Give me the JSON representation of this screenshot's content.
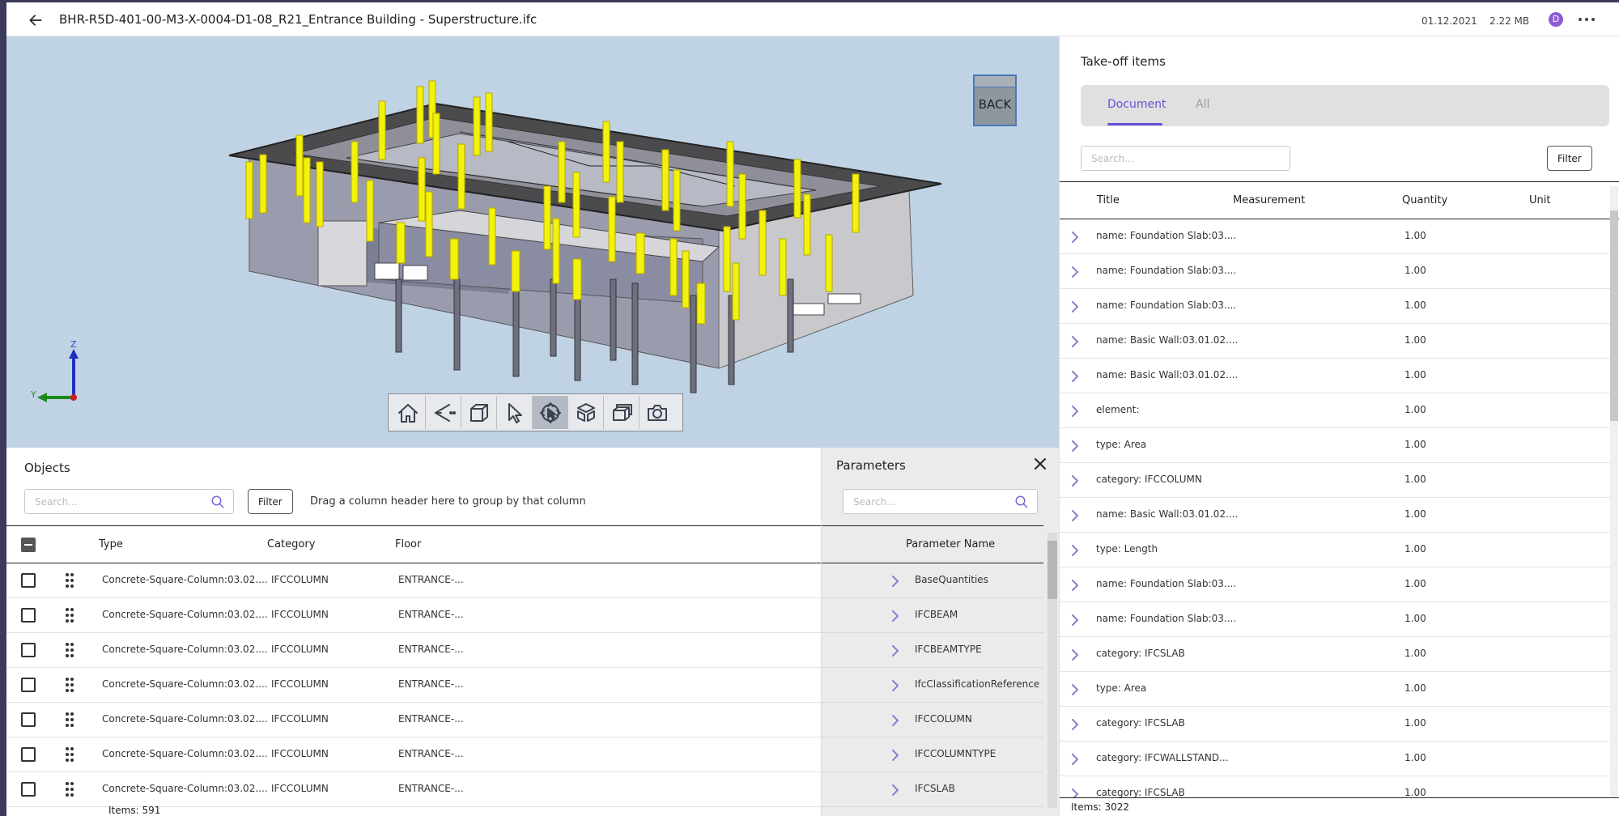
{
  "header": {
    "title": "BHR-R5D-401-00-M3-X-0004-D1-08_R21_Entrance Building - Superstructure.ifc",
    "date": "01.12.2021",
    "size": "2.22 MB",
    "user_initial": "D",
    "icons": {
      "back": "arrow-left-icon",
      "more": "more-horizontal-icon"
    }
  },
  "viewer": {
    "view_cube_label": "BACK",
    "axis_labels": {
      "z": "Z",
      "y": "Y"
    },
    "toolbar": [
      {
        "name": "home-icon"
      },
      {
        "name": "camera-fov-icon"
      },
      {
        "name": "cube-view-icon"
      },
      {
        "name": "pointer-select-icon"
      },
      {
        "name": "orbit-icon",
        "active": true
      },
      {
        "name": "explode-model-icon"
      },
      {
        "name": "section-box-icon"
      },
      {
        "name": "screenshot-camera-icon"
      }
    ]
  },
  "objects": {
    "title": "Objects",
    "search_placeholder": "Search...",
    "filter_label": "Filter",
    "group_hint": "Drag a column header here to group by that column",
    "columns": [
      "Type",
      "Category",
      "Floor"
    ],
    "rows": [
      {
        "type": "Concrete-Square-Column:03.02....",
        "category": "IFCCOLUMN",
        "floor": "ENTRANCE-..."
      },
      {
        "type": "Concrete-Square-Column:03.02....",
        "category": "IFCCOLUMN",
        "floor": "ENTRANCE-..."
      },
      {
        "type": "Concrete-Square-Column:03.02....",
        "category": "IFCCOLUMN",
        "floor": "ENTRANCE-..."
      },
      {
        "type": "Concrete-Square-Column:03.02....",
        "category": "IFCCOLUMN",
        "floor": "ENTRANCE-..."
      },
      {
        "type": "Concrete-Square-Column:03.02....",
        "category": "IFCCOLUMN",
        "floor": "ENTRANCE-..."
      },
      {
        "type": "Concrete-Square-Column:03.02....",
        "category": "IFCCOLUMN",
        "floor": "ENTRANCE-..."
      },
      {
        "type": "Concrete-Square-Column:03.02....",
        "category": "IFCCOLUMN",
        "floor": "ENTRANCE-..."
      }
    ],
    "items_label": "Items:",
    "items_count": "591"
  },
  "parameters": {
    "title": "Parameters",
    "search_placeholder": "Search...",
    "column": "Parameter Name",
    "rows": [
      "BaseQuantities",
      "IFCBEAM",
      "IFCBEAMTYPE",
      "IfcClassificationReference",
      "IFCCOLUMN",
      "IFCCOLUMNTYPE",
      "IFCSLAB"
    ]
  },
  "takeoff": {
    "title": "Take-off items",
    "tabs": [
      "Document",
      "All"
    ],
    "active_tab": "Document",
    "search_placeholder": "Search...",
    "filter_label": "Filter",
    "columns": [
      "Title",
      "Measurement",
      "Quantity",
      "Unit"
    ],
    "rows": [
      {
        "title": "name: Foundation Slab:03....",
        "quantity": "1.00"
      },
      {
        "title": "name: Foundation Slab:03....",
        "quantity": "1.00"
      },
      {
        "title": "name: Foundation Slab:03....",
        "quantity": "1.00"
      },
      {
        "title": "name: Basic Wall:03.01.02....",
        "quantity": "1.00"
      },
      {
        "title": "name: Basic Wall:03.01.02....",
        "quantity": "1.00"
      },
      {
        "title": "element:",
        "quantity": "1.00"
      },
      {
        "title": "type: Area",
        "quantity": "1.00"
      },
      {
        "title": "category: IFCCOLUMN",
        "quantity": "1.00"
      },
      {
        "title": "name: Basic Wall:03.01.02....",
        "quantity": "1.00"
      },
      {
        "title": "type: Length",
        "quantity": "1.00"
      },
      {
        "title": "name: Foundation Slab:03....",
        "quantity": "1.00"
      },
      {
        "title": "name: Foundation Slab:03....",
        "quantity": "1.00"
      },
      {
        "title": "category: IFCSLAB",
        "quantity": "1.00"
      },
      {
        "title": "type: Area",
        "quantity": "1.00"
      },
      {
        "title": "category: IFCSLAB",
        "quantity": "1.00"
      },
      {
        "title": "category: IFCWALLSTAND...",
        "quantity": "1.00"
      },
      {
        "title": "category: IFCSLAB",
        "quantity": "1.00"
      }
    ],
    "items_label": "Items:",
    "items_count": "3022"
  },
  "colors": {
    "accent": "#6b4fd6",
    "viewer_bg": "#c0d3e4",
    "highlight": "#f2f20c"
  }
}
